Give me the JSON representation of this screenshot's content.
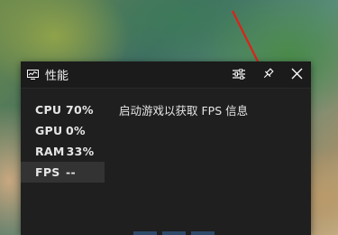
{
  "window": {
    "title": "性能",
    "icons": {
      "app": "performance-monitor-icon",
      "options": "sliders-icon",
      "pin": "pin-icon",
      "close": "close-icon"
    }
  },
  "metrics": [
    {
      "label": "CPU",
      "value": "70%"
    },
    {
      "label": "GPU",
      "value": "0%"
    },
    {
      "label": "RAM",
      "value": "33%"
    },
    {
      "label": "FPS",
      "value": "--"
    }
  ],
  "selected_metric": "FPS",
  "info_message": "启动游戏以获取 FPS 信息",
  "colors": {
    "panel_bg": "#1f1f1f",
    "titlebar_bg": "#1b1b1b",
    "selected_bg": "#333333",
    "text": "#e6e6e6",
    "arrow": "#e0201a"
  }
}
